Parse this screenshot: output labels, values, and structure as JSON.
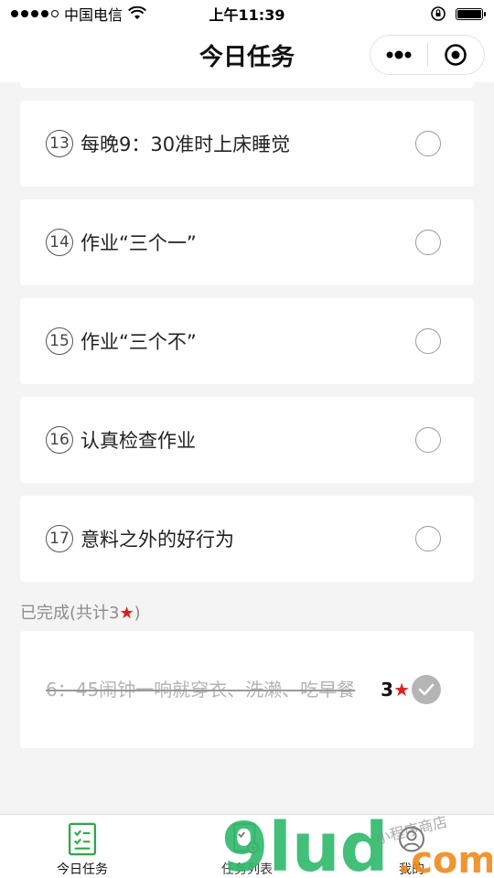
{
  "status_bar": {
    "carrier": "中国电信",
    "time": "上午11:39"
  },
  "header": {
    "title": "今日任务"
  },
  "tasks": [
    {
      "num": "13",
      "text": "每晚9：30准时上床睡觉"
    },
    {
      "num": "14",
      "text": "作业“三个一”"
    },
    {
      "num": "15",
      "text": "作业“三个不”"
    },
    {
      "num": "16",
      "text": "认真检查作业"
    },
    {
      "num": "17",
      "text": "意料之外的好行为"
    }
  ],
  "completed": {
    "label": "已完成(共计3",
    "label_end": ")",
    "star": "★",
    "items": [
      {
        "text": "6：45闹钟一响就穿衣、洗濑、吃早餐",
        "score": "3"
      }
    ]
  },
  "tabbar": {
    "items": [
      {
        "label": "今日任务",
        "icon": "task-check-icon",
        "active": true
      },
      {
        "label": "任务列表",
        "icon": "task-list-icon",
        "active": false
      },
      {
        "label": "我的",
        "icon": "profile-icon",
        "active": false
      }
    ]
  },
  "watermark": {
    "text": "9lud.com",
    "subtext": "小程序商店"
  },
  "colors": {
    "tab_active": "#2fa64a",
    "star": "#d8211e",
    "watermark_green": "#2db86a",
    "watermark_orange": "#ef8a1a"
  }
}
